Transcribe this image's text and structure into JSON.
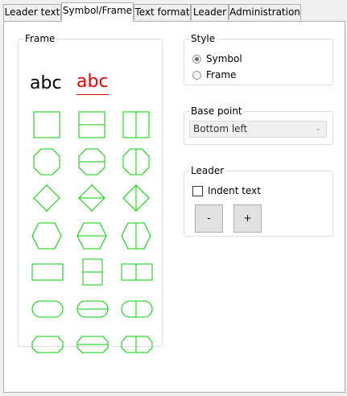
{
  "tabs": [
    {
      "label": "Leader text",
      "active": false
    },
    {
      "label": "Symbol/Frame",
      "active": true
    },
    {
      "label": "Text format",
      "active": false
    },
    {
      "label": "Leader",
      "active": false
    },
    {
      "label": "Administration",
      "active": false
    }
  ],
  "frame_group": {
    "title": "Frame",
    "sample_plain": "abc",
    "sample_styled": "abc",
    "shape_rows": [
      [
        "square",
        "square-split-horizontal",
        "square-split-vertical"
      ],
      [
        "octagon",
        "octagon-split-horizontal",
        "octagon-split-vertical"
      ],
      [
        "diamond",
        "diamond-split-horizontal",
        "diamond-split-vertical"
      ],
      [
        "hexagon",
        "hexagon-split-horizontal",
        "hexagon-split-vertical"
      ],
      [
        "rectangle",
        "rectangle-split-horizontal",
        "rectangle-split-vertical"
      ],
      [
        "capsule",
        "capsule-split-horizontal",
        "capsule-split-vertical"
      ],
      [
        "flat-hexagon",
        "flat-hexagon-split-horizontal",
        "flat-hexagon-split-vertical"
      ]
    ]
  },
  "style_group": {
    "title": "Style",
    "options": [
      {
        "label": "Symbol",
        "checked": true
      },
      {
        "label": "Frame",
        "checked": false
      }
    ]
  },
  "base_point_group": {
    "title": "Base point",
    "selected": "Bottom left",
    "enabled": false
  },
  "leader_group": {
    "title": "Leader",
    "indent_label": "Indent text",
    "indent_checked": false,
    "minus_label": "-",
    "plus_label": "+"
  },
  "colors": {
    "shape_stroke": "#00cc00",
    "sample_styled": "#e00000"
  }
}
